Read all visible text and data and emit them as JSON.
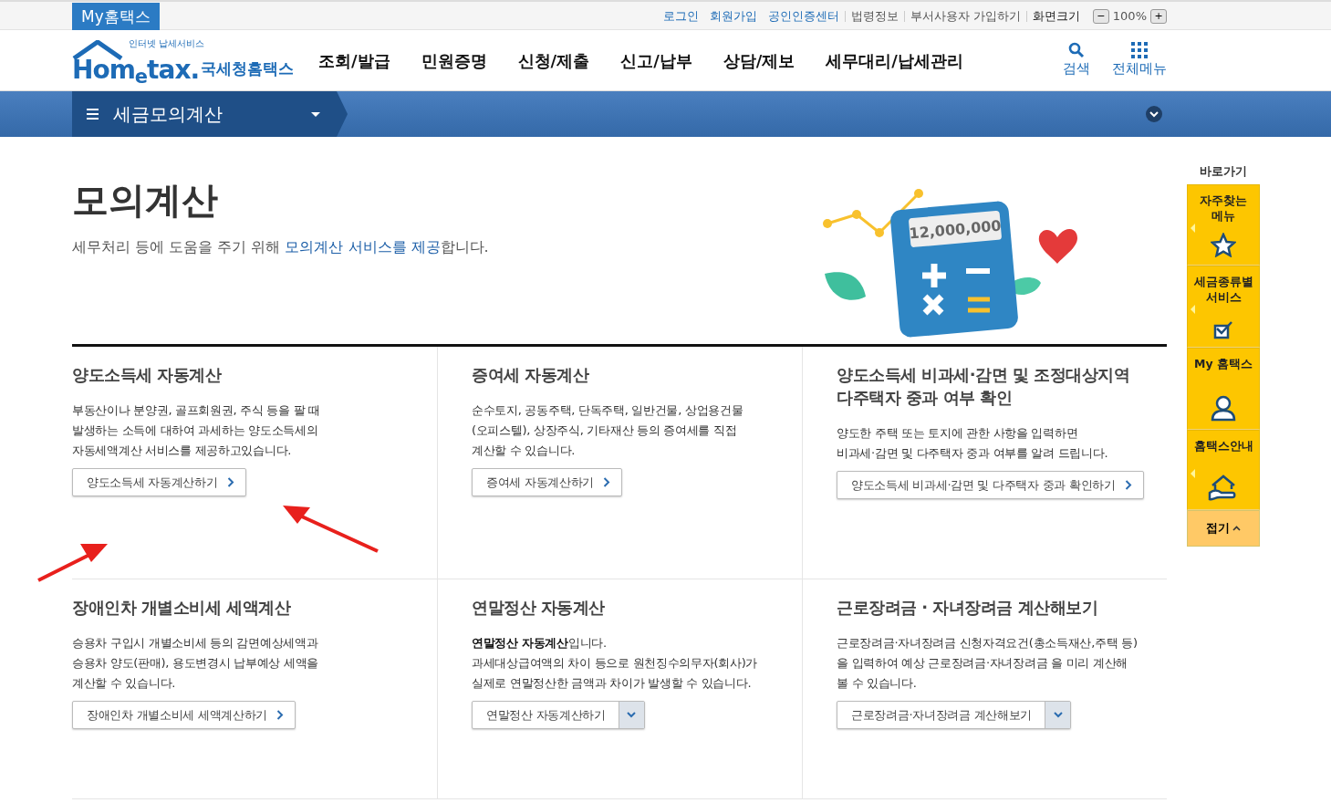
{
  "top_bar": {
    "brand": "My홈택스",
    "links": [
      {
        "label": "로그인",
        "highlight": true
      },
      {
        "label": "회원가입",
        "highlight": true
      },
      {
        "label": "공인인증센터",
        "highlight": true
      },
      {
        "label": "법령정보",
        "highlight": false
      },
      {
        "label": "부서사용자 가입하기",
        "highlight": false
      }
    ],
    "zoom_label": "화면크기",
    "zoom_out": "−",
    "zoom_value": "100%",
    "zoom_in": "+"
  },
  "header": {
    "logo_tagline": "인터넷 납세서비스",
    "logo_word": "Hom$_{e}$tax.",
    "logo_name": "국세청홈택스",
    "nav": [
      "조회/발급",
      "민원증명",
      "신청/제출",
      "신고/납부",
      "상담/제보",
      "세무대리/납세관리"
    ],
    "tools": [
      {
        "label": "검색",
        "kind": "search"
      },
      {
        "label": "전체메뉴",
        "kind": "grid"
      }
    ]
  },
  "breadcrumb": {
    "label": "세금모의계산"
  },
  "page": {
    "title": "모의계산",
    "subtitle": "세무처리 등에 도움을 주기 위해 **모의계산 서비스를 제공**합니다.",
    "illustration": {
      "kind": "picture",
      "display": "12,000,000"
    }
  },
  "cards": [
    {
      "title": [
        "양도소득세 자동계산"
      ],
      "description": [
        "부동산이나 분양권, 골프회원권, 주식 등을 팔 때",
        "발생하는 소득에 대하여 과세하는 양도소득세의",
        "자동세액계산 서비스를 제공하고있습니다."
      ],
      "button": {
        "label": "양도소득세 자동계산하기",
        "kind": "arrow"
      }
    },
    {
      "title": [
        "증여세 자동계산"
      ],
      "description": [
        "순수토지, 공동주택, 단독주택, 일반건물, 상업용건물",
        "(오피스텔), 상장주식, 기타재산 등의 증여세를 직접",
        "계산할 수 있습니다."
      ],
      "button": {
        "label": "증여세 자동계산하기",
        "kind": "arrow"
      }
    },
    {
      "title": [
        "양도소득세 비과세·감면 및 조정대상지역",
        "다주택자 중과 여부 확인"
      ],
      "description": [
        "양도한 주택 또는 토지에 관한 사항을 입력하면",
        "비과세·감면 및 다주택자 중과 여부를 알려 드립니다."
      ],
      "button": {
        "label": "양도소득세 비과세·감면 및 다주택자 중과 확인하기",
        "kind": "arrow"
      }
    },
    {
      "title": [
        "장애인차 개별소비세 세액계산"
      ],
      "description": [
        "승용차 구입시 개별소비세 등의 감면예상세액과",
        "승용차 양도(판매), 용도변경시 납부예상 세액을",
        "계산할 수 있습니다."
      ],
      "button": {
        "label": "장애인차 개별소비세 세액계산하기",
        "kind": "arrow"
      }
    },
    {
      "title": [
        "연말정산 자동계산"
      ],
      "description": [
        "**연말정산 자동계산**입니다.",
        "과세대상급여액의 차이 등으로 원천징수의무자(회사)가",
        "실제로 연말정산한 금액과 차이가 발생할 수 있습니다."
      ],
      "button": {
        "label": "연말정산 자동계산하기",
        "kind": "dropdown"
      }
    },
    {
      "title": [
        "근로장려금 · 자녀장려금 계산해보기"
      ],
      "description": [
        "근로장려금·자녀장려금 신청자격요건(총소득재산,주택 등)",
        "을 입력하여 예상 근로장려금·자녀장려금 을 미리 계산해",
        "볼 수 있습니다."
      ],
      "button": {
        "label": "근로장려금·자녀장려금 계산해보기",
        "kind": "dropdown"
      }
    }
  ],
  "quick_menu": {
    "title": "바로가기",
    "items": [
      {
        "label": [
          "자주찾는",
          "메뉴"
        ],
        "kind": "star",
        "expandable": true
      },
      {
        "label": [
          "세금종류별",
          "서비스"
        ],
        "kind": "check",
        "expandable": true
      },
      {
        "label": [
          "My 홈택스"
        ],
        "kind": "person",
        "expandable": false
      },
      {
        "label": [
          "홈택스안내"
        ],
        "kind": "house",
        "expandable": true
      }
    ],
    "fold": "접기"
  }
}
